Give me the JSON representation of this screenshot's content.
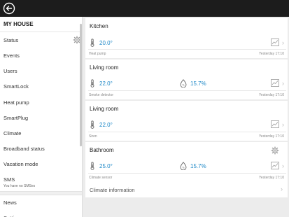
{
  "topbar": {
    "back_icon": "back-arrow-icon"
  },
  "sidebar": {
    "title": "MY HOUSE",
    "items": [
      "Status",
      "Events",
      "Users",
      "SmartLock",
      "Heat pump",
      "SmartPlug",
      "Climate",
      "Broadband status",
      "Vacation mode"
    ],
    "sms": {
      "label": "SMS",
      "sub": "You have no SMSes"
    },
    "bottom_items": [
      "News",
      "Settings"
    ]
  },
  "cards": [
    {
      "title": "Kitchen",
      "temp": "20.0°",
      "humidity": null,
      "device": "Heat pump",
      "time": "Yesterday 17:10"
    },
    {
      "title": "Living room",
      "temp": "22.0°",
      "humidity": "15.7%",
      "device": "Smoke detector",
      "time": "Yesterday 17:10"
    },
    {
      "title": "Living room",
      "temp": "22.0°",
      "humidity": null,
      "device": "Siren",
      "time": "Yesterday 17:10"
    },
    {
      "title": "Bathroom",
      "temp": "25.0°",
      "humidity": "15.7%",
      "device": "Climate sensor",
      "time": "Yesterday 17:10"
    }
  ],
  "climate_info": "Climate information",
  "colors": {
    "topbar": "#1c1c1c",
    "accent": "#1e88c7"
  }
}
